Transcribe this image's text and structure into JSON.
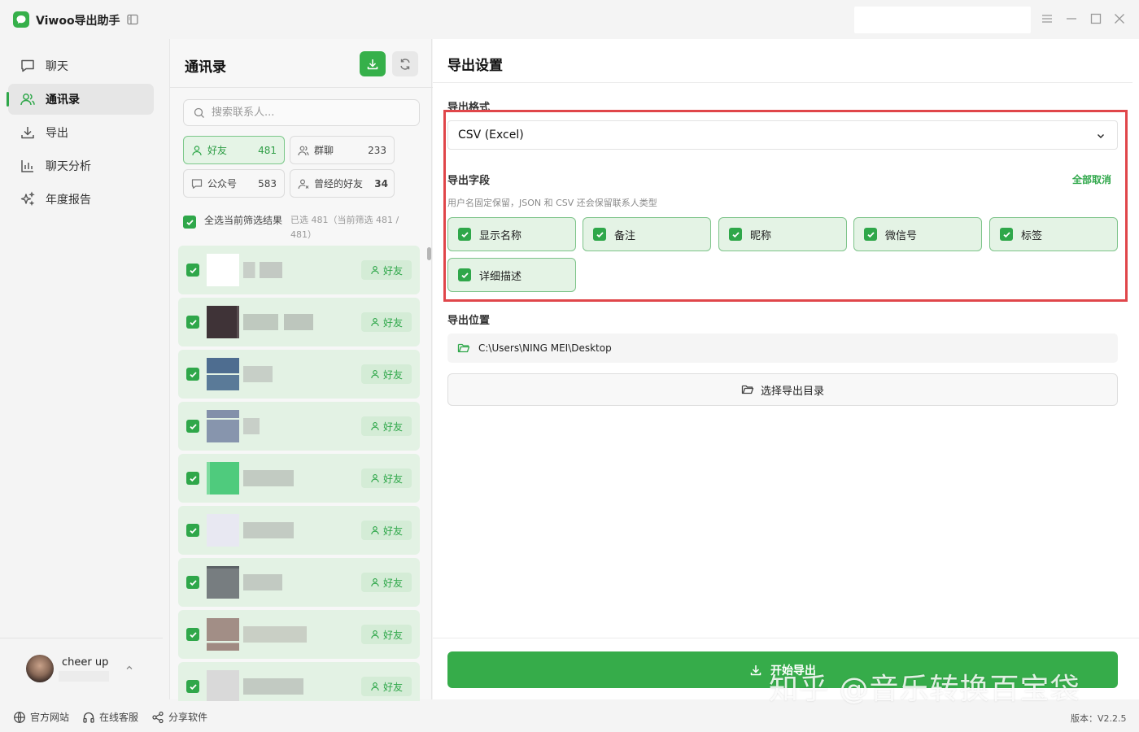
{
  "app": {
    "title": "Viwoo导出助手"
  },
  "sidebar": {
    "items": [
      {
        "label": "聊天",
        "icon": "chat-icon"
      },
      {
        "label": "通讯录",
        "icon": "contacts-icon",
        "active": true
      },
      {
        "label": "导出",
        "icon": "download-icon"
      },
      {
        "label": "聊天分析",
        "icon": "bar-chart-icon"
      },
      {
        "label": "年度报告",
        "icon": "sparkle-icon"
      }
    ],
    "user": {
      "name": "cheer up"
    }
  },
  "contacts": {
    "title": "通讯录",
    "search_placeholder": "搜索联系人...",
    "filters": [
      {
        "label": "好友",
        "count": "481",
        "active": true
      },
      {
        "label": "群聊",
        "count": "233"
      },
      {
        "label": "公众号",
        "count": "583"
      },
      {
        "label": "曾经的好友",
        "count": "34"
      }
    ],
    "select_all_label": "全选当前筛选结果",
    "select_all_count": "已选 481（当前筛选 481 / 481）",
    "row_tag": "好友"
  },
  "settings": {
    "title": "导出设置",
    "format_label": "导出格式",
    "format_value": "CSV (Excel)",
    "fields_label": "导出字段",
    "cancel_all": "全部取消",
    "fields_hint": "用户名固定保留，JSON 和 CSV 还会保留联系人类型",
    "fields": [
      "显示名称",
      "备注",
      "昵称",
      "微信号",
      "标签",
      "详细描述"
    ],
    "location_label": "导出位置",
    "location_path": "C:\\Users\\NING MEI\\Desktop",
    "choose_dir": "选择导出目录",
    "start_export": "开始导出"
  },
  "footer": {
    "website": "官方网站",
    "support": "在线客服",
    "share": "分享软件",
    "version": "版本：V2.2.5"
  },
  "watermark": "知乎 @音乐转换百宝袋",
  "colors": {
    "accent": "#36b04a",
    "highlight_border": "#e0464a"
  }
}
